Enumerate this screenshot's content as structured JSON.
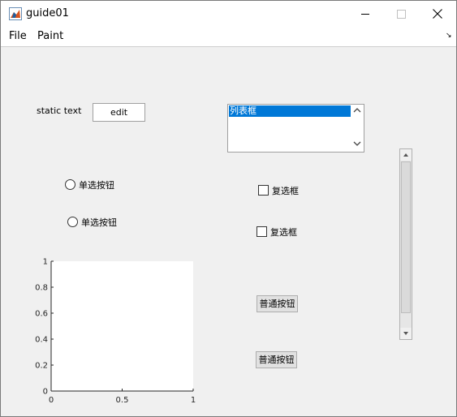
{
  "window": {
    "title": "guide01",
    "icon": "matlab-figure-icon"
  },
  "menu": {
    "items": [
      "File",
      "Paint"
    ],
    "overflow_icon": "chevron-corner-icon"
  },
  "controls": {
    "static_text": "static text",
    "edit": "edit",
    "listbox": {
      "items": [
        "列表框"
      ],
      "selected_index": 0
    },
    "radios": [
      "单选按钮",
      "单选按钮"
    ],
    "checkboxes": [
      "复选框",
      "复选框"
    ],
    "buttons": [
      "普通按钮",
      "普通按钮"
    ],
    "slider": {
      "value": 0.0
    }
  },
  "chart_data": {
    "type": "line",
    "title": "",
    "xlabel": "",
    "ylabel": "",
    "xlim": [
      0,
      1
    ],
    "ylim": [
      0,
      1
    ],
    "xticks": [
      "0",
      "0.5",
      "1"
    ],
    "yticks": [
      "0",
      "0.2",
      "0.4",
      "0.6",
      "0.8",
      "1"
    ],
    "series": []
  },
  "colors": {
    "selection": "#0078d7",
    "panel": "#f0f0f0"
  }
}
